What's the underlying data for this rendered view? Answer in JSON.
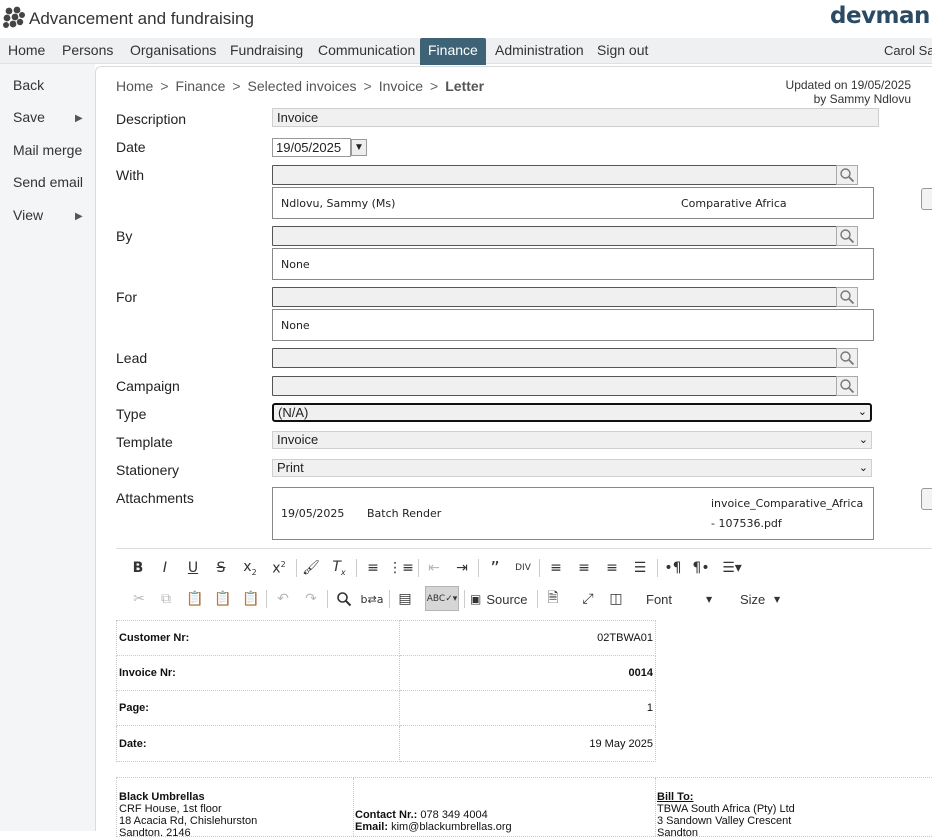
{
  "app": {
    "title": "Advancement and fundraising",
    "brand": "devman",
    "user": "Carol Sa"
  },
  "nav": [
    "Home",
    "Persons",
    "Organisations",
    "Fundraising",
    "Communication",
    "Finance",
    "Administration",
    "Sign out"
  ],
  "sidebar": {
    "back": "Back",
    "save": "Save",
    "mail_merge": "Mail merge",
    "send_email": "Send email",
    "view": "View"
  },
  "breadcrumb": {
    "home": "Home",
    "finance": "Finance",
    "selected": "Selected invoices",
    "invoice": "Invoice",
    "current": "Letter",
    "sep": ">"
  },
  "updated": {
    "line1": "Updated on 19/05/2025",
    "line2": "by Sammy Ndlovu"
  },
  "form": {
    "description_label": "Description",
    "description_value": "Invoice",
    "date_label": "Date",
    "date_value": "19/05/2025",
    "with_label": "With",
    "with_person": "Ndlovu, Sammy (Ms)",
    "with_org": "Comparative Africa",
    "by_label": "By",
    "by_value": "None",
    "for_label": "For",
    "for_value": "None",
    "lead_label": "Lead",
    "campaign_label": "Campaign",
    "type_label": "Type",
    "type_value": "(N/A)",
    "template_label": "Template",
    "template_value": "Invoice",
    "stationery_label": "Stationery",
    "stationery_value": "Print",
    "attachments_label": "Attachments",
    "attachment_date": "19/05/2025",
    "attachment_desc": "Batch Render",
    "attachment_file_1": "invoice_Comparative_Africa",
    "attachment_file_2": "- 107536.pdf"
  },
  "toolbar": {
    "source": "Source",
    "font": "Font",
    "size": "Size"
  },
  "doc": {
    "rows": [
      {
        "label": "Customer Nr:",
        "value": "02TBWA01"
      },
      {
        "label": "Invoice Nr:",
        "value": "0014"
      },
      {
        "label": "Page:",
        "value": "1"
      },
      {
        "label": "Date:",
        "value": "19 May 2025"
      }
    ],
    "company": "Black Umbrellas",
    "company_addr1": "CRF House, 1st floor",
    "company_addr2": "18 Acacia Rd, Chislehurston",
    "company_addr3": "Sandton, 2146",
    "contact_label": "Contact Nr.:",
    "contact_value": "078 349 4004",
    "email_label": "Email:",
    "email_value": "kim@blackumbrellas.org",
    "bill_to": "Bill To:",
    "bill_name": "TBWA South Africa (Pty) Ltd",
    "bill_addr1": "3 Sandown Valley Crescent",
    "bill_addr2": "Sandton"
  },
  "colors": {
    "nav_active": "#3e6377",
    "brand": "#2b4a63",
    "sidebar_bg": "#f3f5f6"
  }
}
